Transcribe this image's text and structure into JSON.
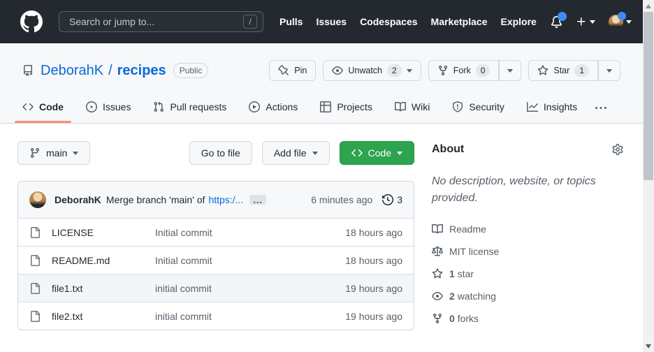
{
  "navbar": {
    "search": {
      "placeholder": "Search or jump to...",
      "shortcut": "/"
    },
    "links": [
      "Pulls",
      "Issues",
      "Codespaces",
      "Marketplace",
      "Explore"
    ]
  },
  "repo_header": {
    "owner": "DeborahK",
    "separator": "/",
    "name": "recipes",
    "visibility": "Public",
    "actions": {
      "pin": {
        "label": "Pin"
      },
      "watch": {
        "label": "Unwatch",
        "count": "2"
      },
      "fork": {
        "label": "Fork",
        "count": "0"
      },
      "star": {
        "label": "Star",
        "count": "1"
      }
    }
  },
  "tabs": [
    {
      "label": "Code"
    },
    {
      "label": "Issues"
    },
    {
      "label": "Pull requests"
    },
    {
      "label": "Actions"
    },
    {
      "label": "Projects"
    },
    {
      "label": "Wiki"
    },
    {
      "label": "Security"
    },
    {
      "label": "Insights"
    }
  ],
  "toolbar": {
    "branch": "main",
    "go_to_file": "Go to file",
    "add_file": "Add file",
    "code": "Code"
  },
  "commit_bar": {
    "author": "DeborahK",
    "message": "Merge branch 'main' of",
    "link_text": "https:/...",
    "ellipsis": "…",
    "time": "6 minutes ago",
    "history_count": "3"
  },
  "files": [
    {
      "name": "LICENSE",
      "message": "Initial commit",
      "time": "18 hours ago"
    },
    {
      "name": "README.md",
      "message": "Initial commit",
      "time": "18 hours ago"
    },
    {
      "name": "file1.txt",
      "message": "initial commit",
      "time": "19 hours ago"
    },
    {
      "name": "file2.txt",
      "message": "initial commit",
      "time": "19 hours ago"
    }
  ],
  "sidebar": {
    "title": "About",
    "description": "No description, website, or topics provided.",
    "readme": "Readme",
    "license": "MIT license",
    "stats": {
      "star": {
        "count": "1",
        "label": "star"
      },
      "watching": {
        "count": "2",
        "label": "watching"
      },
      "forks": {
        "count": "0",
        "label": "forks"
      }
    }
  },
  "colors": {
    "header_bg": "#24292f",
    "accent_green": "#2da44e",
    "link_blue": "#0969da",
    "tab_underline": "#fd8c73",
    "notification_blue": "#3c8cf8"
  }
}
